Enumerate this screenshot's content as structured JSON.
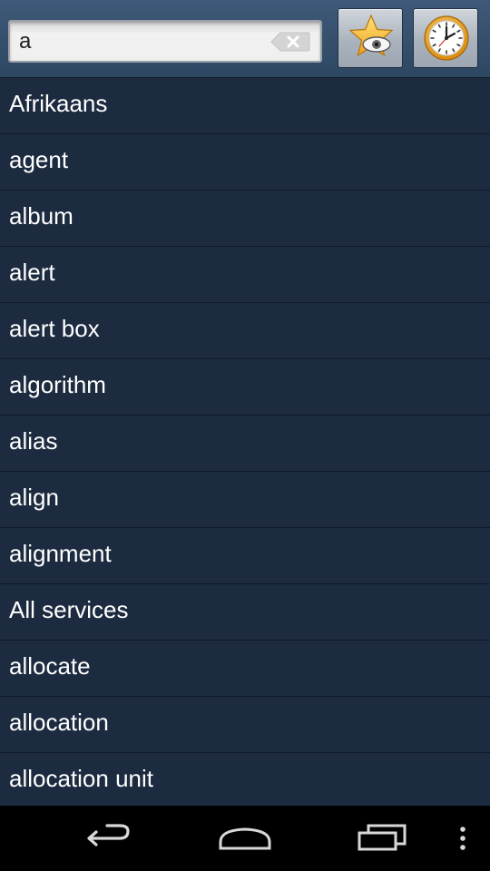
{
  "search": {
    "value": "a",
    "clear_icon": "backspace-clear-icon"
  },
  "toolbar": {
    "favorites_icon": "star-eye-icon",
    "history_icon": "clock-icon"
  },
  "words": [
    "Afrikaans",
    "agent",
    "album",
    "alert",
    "alert box",
    "algorithm",
    "alias",
    "align",
    "alignment",
    "All services",
    "allocate",
    "allocation",
    "allocation unit"
  ],
  "navbar": {
    "back_icon": "back-arrow-icon",
    "home_icon": "home-icon",
    "recents_icon": "recent-apps-icon",
    "menu_icon": "overflow-menu-icon"
  },
  "colors": {
    "list_background": "#1c2b40",
    "topbar": "#3e5a78",
    "navbar": "#000000",
    "text": "#ffffff"
  }
}
